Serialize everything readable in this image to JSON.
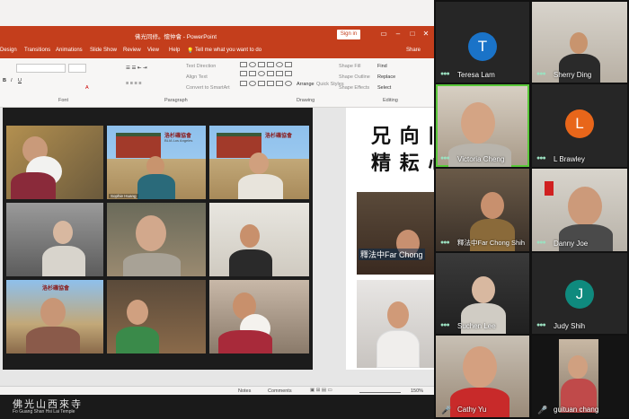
{
  "ppt": {
    "window_title": "佛光同修。懷仲會 - PowerPoint",
    "sign_in": "Sign in",
    "tabs": [
      "Design",
      "Transitions",
      "Animations",
      "Slide Show",
      "Review",
      "View",
      "Help"
    ],
    "tell_me": "Tell me what you want to do",
    "share": "Share",
    "ribbon": {
      "text_direction": "Text Direction",
      "align_text": "Align Text",
      "convert_smartart": "Convert to SmartArt",
      "arrange": "Arrange",
      "quick_styles": "Quick Styles",
      "shape_fill": "Shape Fill",
      "shape_outline": "Shape Outline",
      "shape_effects": "Shape Effects",
      "find": "Find",
      "replace": "Replace",
      "select": "Select",
      "groups": [
        "Font",
        "Paragraph",
        "Drawing",
        "Editing"
      ]
    },
    "slide": {
      "sign_text": "洛杉磯協會",
      "sign_sub": "BLIA Los Angeles",
      "tile_name": "Sophie Huang",
      "calligraphy_top": "兄 向 旧",
      "calligraphy_bottom": "精 耘 心",
      "side_name": "釋法中Far Chong"
    },
    "status": {
      "notes": "Notes",
      "comments": "Comments",
      "zoom": "150%"
    }
  },
  "logo": {
    "chinese": "佛光山西來寺",
    "english": "Fo Guang Shan Hsi Lai Temple"
  },
  "gallery": [
    {
      "name": "Teresa Lam",
      "type": "avatar",
      "letter": "T",
      "color": "#1a73c8"
    },
    {
      "name": "Sherry Ding",
      "type": "video"
    },
    {
      "name": "Victoria Cheng",
      "type": "video",
      "active": true
    },
    {
      "name": "L Brawley",
      "type": "avatar",
      "letter": "L",
      "color": "#e8661a"
    },
    {
      "name": "釋法中Far Chong Shih",
      "type": "video"
    },
    {
      "name": "Danny Joe",
      "type": "video"
    },
    {
      "name": "Suchen Lee",
      "type": "video"
    },
    {
      "name": "Judy Shih",
      "type": "avatar",
      "letter": "J",
      "color": "#0f8a7e"
    },
    {
      "name": "Cathy Yu",
      "type": "video",
      "muted": true
    },
    {
      "name": "guituan chang",
      "type": "video",
      "muted": true
    }
  ],
  "colors": {
    "ppt_accent": "#c43e1c",
    "active_speaker": "#5ac83a"
  }
}
